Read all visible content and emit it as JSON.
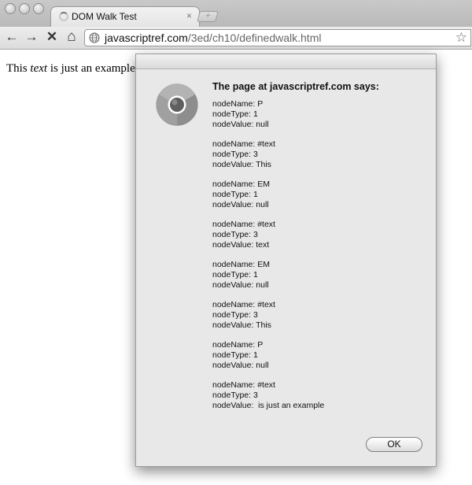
{
  "tab": {
    "title": "DOM Walk Test",
    "close_glyph": "×",
    "new_tab_glyph": "+"
  },
  "toolbar": {
    "back_glyph": "←",
    "forward_glyph": "→",
    "stop_glyph": "✕",
    "home_glyph": "⌂",
    "url_domain": "javascriptref.com",
    "url_path": "/3ed/ch10/definedwalk.html",
    "bookmark_glyph": "☆"
  },
  "page": {
    "text_before": "This ",
    "text_em": "text",
    "text_after": " is just an example"
  },
  "dialog": {
    "heading": "The page at javascriptref.com says:",
    "lines": [
      "nodeName: P",
      "nodeType: 1",
      "nodeValue: null",
      "",
      "nodeName: #text",
      "nodeType: 3",
      "nodeValue: This",
      "",
      "nodeName: EM",
      "nodeType: 1",
      "nodeValue: null",
      "",
      "nodeName: #text",
      "nodeType: 3",
      "nodeValue: text",
      "",
      "nodeName: EM",
      "nodeType: 1",
      "nodeValue: null",
      "",
      "nodeName: #text",
      "nodeType: 3",
      "nodeValue: This",
      "",
      "nodeName: P",
      "nodeType: 1",
      "nodeValue: null",
      "",
      "nodeName: #text",
      "nodeType: 3",
      "nodeValue:  is just an example"
    ],
    "ok_label": "OK"
  },
  "icons": {
    "traffic_lights": [
      "close-light-icon",
      "minimize-light-icon",
      "zoom-light-icon"
    ],
    "tab_loading": "loading-spinner-icon",
    "omnibox_site": "globe-icon",
    "dialog_app": "chrome-logo-icon"
  }
}
